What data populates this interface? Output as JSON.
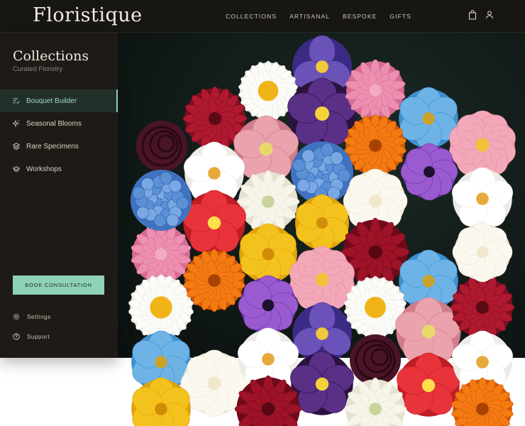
{
  "brand": {
    "logo": "Floristique"
  },
  "nav": {
    "items": [
      "COLLECTIONS",
      "ARTISANAL",
      "BESPOKE",
      "GIFTS"
    ]
  },
  "header_icons": [
    "shopping-bag-icon",
    "user-icon"
  ],
  "sidebar": {
    "title": "Collections",
    "subtitle": "Curated Floristry",
    "items": [
      {
        "label": "Bouquet Builder",
        "icon": "builder-icon",
        "active": true
      },
      {
        "label": "Seasonal Blooms",
        "icon": "sparkle-icon",
        "active": false
      },
      {
        "label": "Rare Specimens",
        "icon": "layers-icon",
        "active": false
      },
      {
        "label": "Workshops",
        "icon": "graduation-icon",
        "active": false
      }
    ],
    "cta": "BOOK CONSULTATION",
    "footer": [
      {
        "label": "Settings",
        "icon": "gear-icon"
      },
      {
        "label": "Support",
        "icon": "help-icon"
      }
    ]
  },
  "colors": {
    "accent": "#8ed2b8",
    "sidebar_bg": "#1e1b17",
    "topbar_bg": "#171613",
    "hero_bg": "#0f1714"
  },
  "hero": {
    "flowers": [
      "iris",
      "dahlia-red",
      "daisy",
      "pansy",
      "peony-pink",
      "poppy-blue",
      "spiral-plum",
      "hellebore-pink",
      "marigold-orange",
      "camellia-pink",
      "hydrangea-blue",
      "orchid-white",
      "anemone-purple",
      "ranunculus-white",
      "hibiscus-red",
      "tulip-yellow",
      "gardenia-white",
      "rose-red",
      "peony-pink",
      "tulip-yellow",
      "camellia-pink",
      "poppy-blue",
      "daisy",
      "marigold-orange",
      "anemone-purple",
      "iris",
      "daisy",
      "hellebore-pink",
      "dahlia-red",
      "orchid-white",
      "poppy-blue",
      "gardenia-white",
      "orchid-white",
      "pansy",
      "spiral-plum",
      "hibiscus-red",
      "orchid-white",
      "tulip-yellow",
      "ranunculus-white",
      "rose-red",
      "gardenia-white",
      "hydrangea-blue",
      "marigold-orange"
    ]
  }
}
